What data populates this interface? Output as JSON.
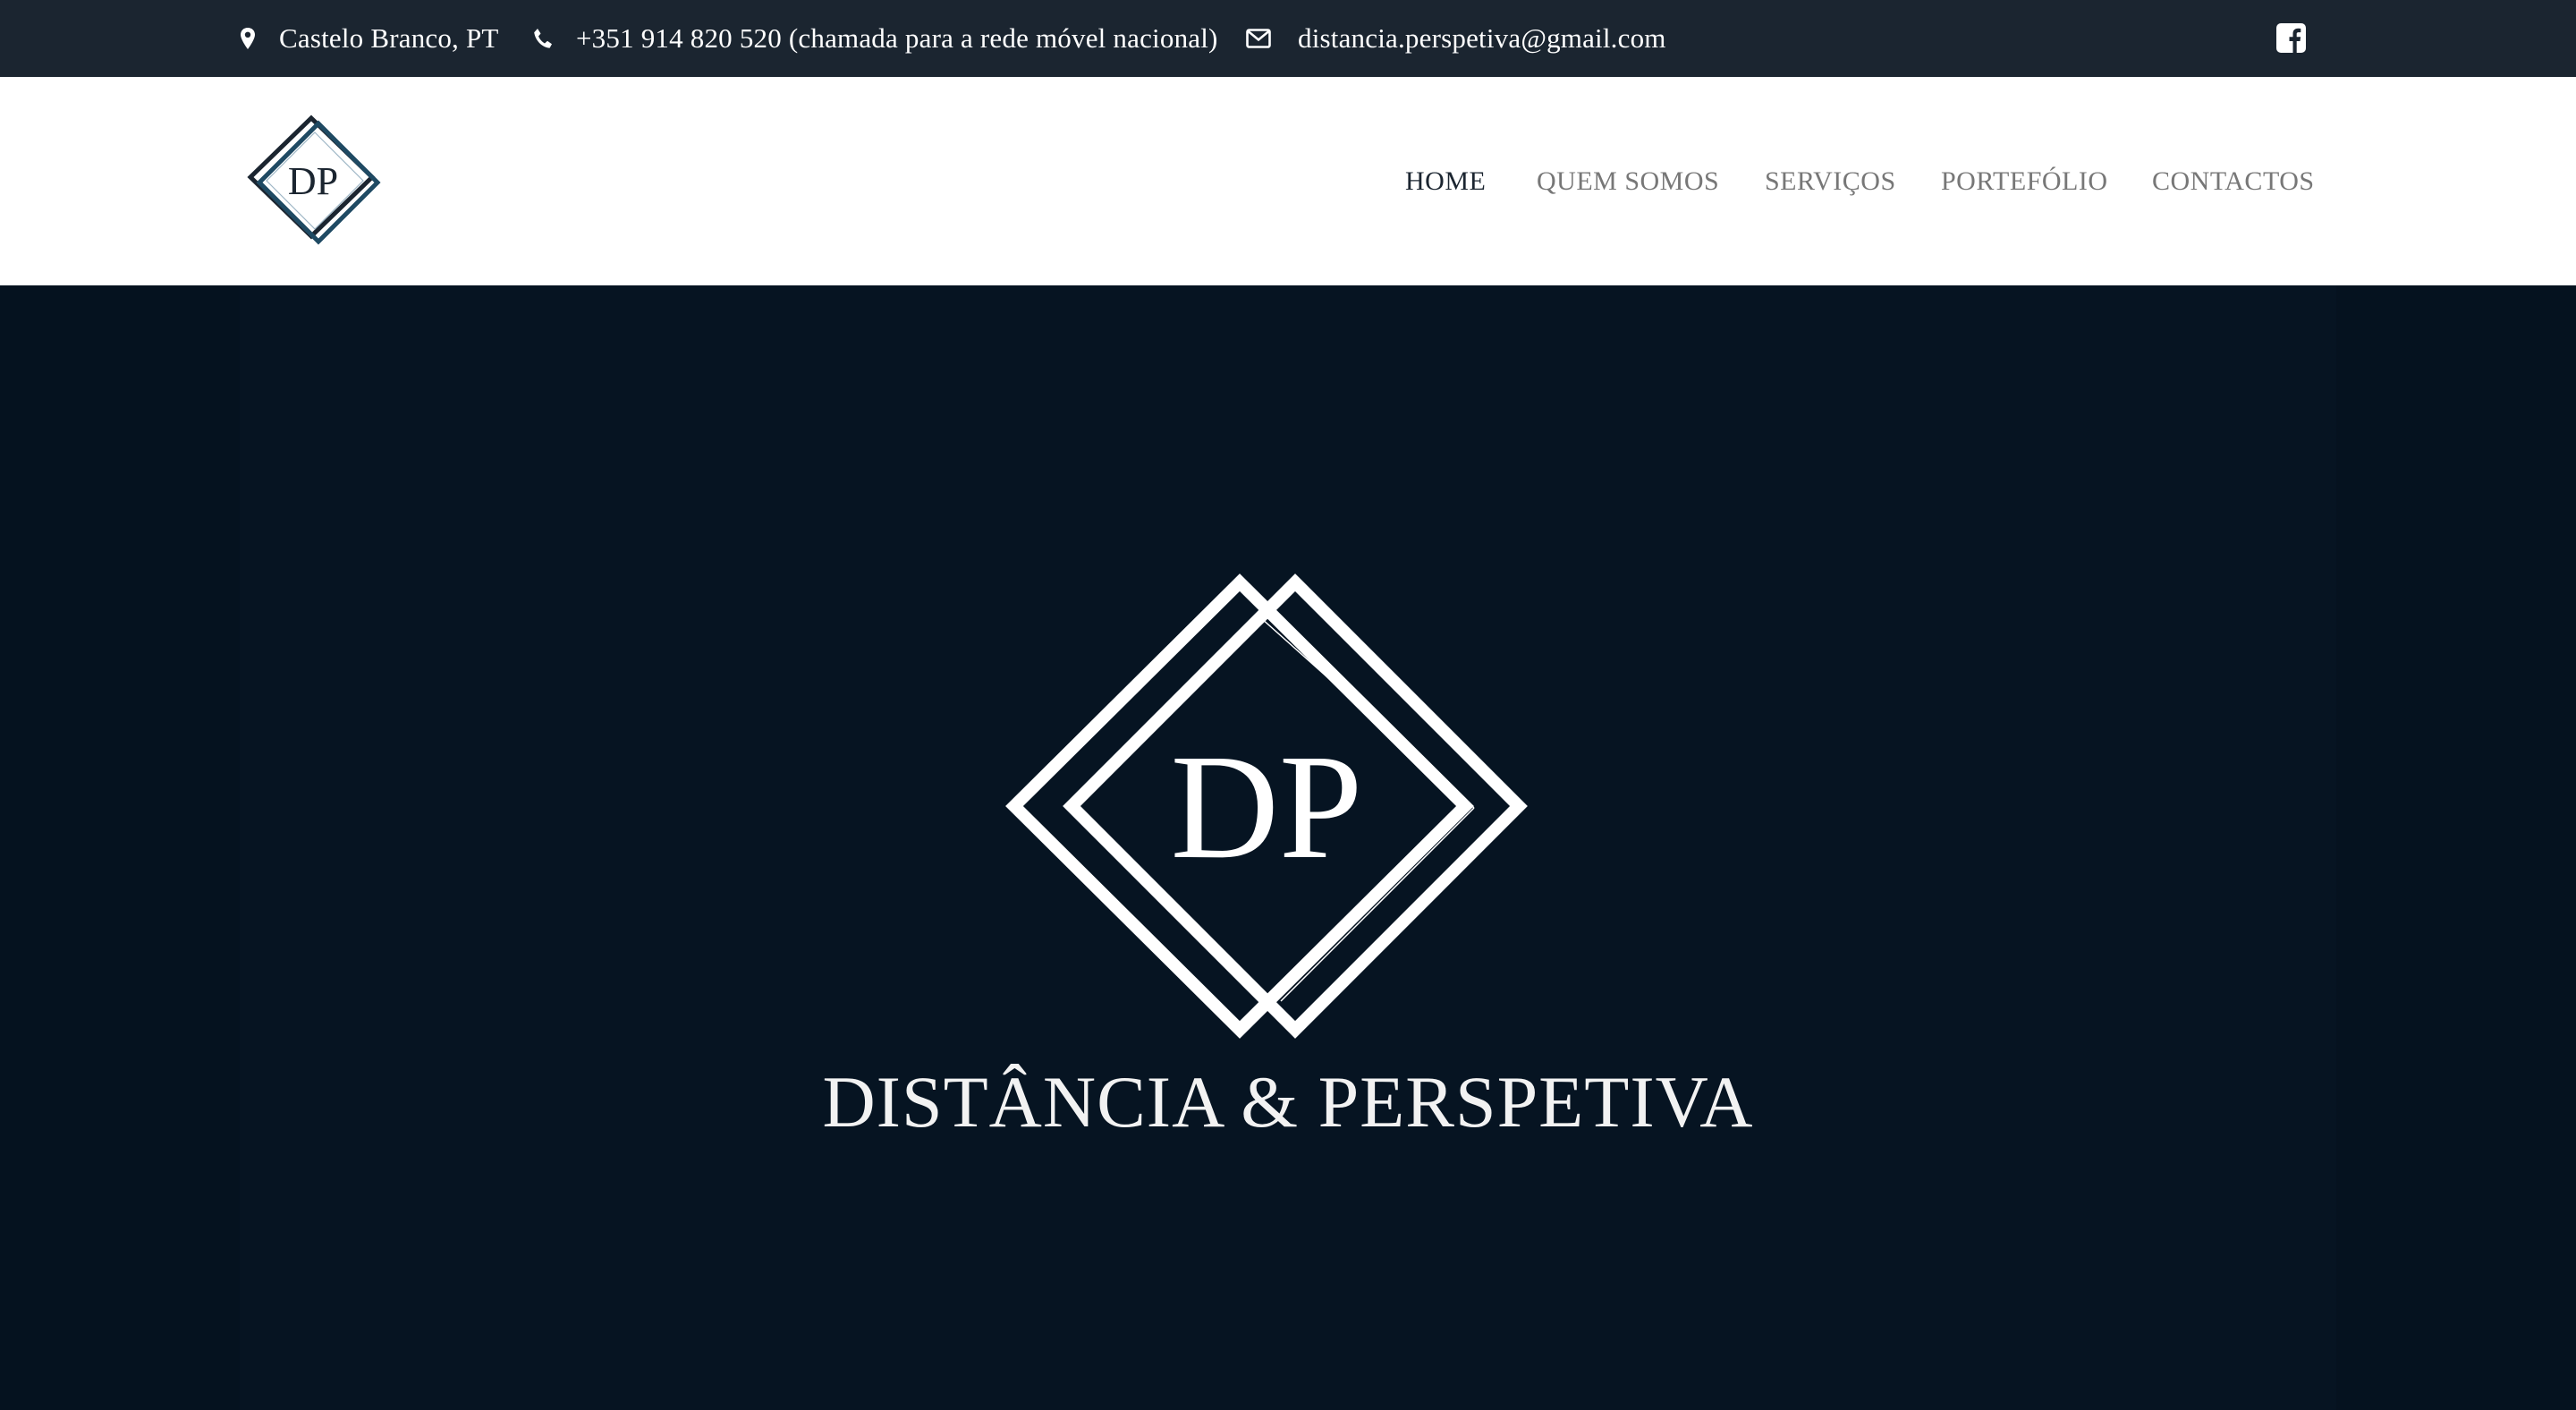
{
  "topbar": {
    "location": "Castelo Branco, PT",
    "location_icon": "map-marker-icon",
    "phone": "+351 914 820 520 (chamada para a rede móvel nacional)",
    "phone_icon": "phone-icon",
    "email": "distancia.perspetiva@gmail.com",
    "email_icon": "envelope-icon",
    "social_icon": "facebook-icon",
    "background": "#1b2530"
  },
  "logo": {
    "monogram": "DP",
    "accent": "#1f4a63"
  },
  "nav": {
    "items": [
      {
        "label": "HOME",
        "active": true
      },
      {
        "label": "QUEM SOMOS",
        "active": false
      },
      {
        "label": "SERVIÇOS",
        "active": false
      },
      {
        "label": "PORTEFÓLIO",
        "active": false
      },
      {
        "label": "CONTACTOS",
        "active": false
      }
    ],
    "active_color": "#1b2530",
    "inactive_color": "#777777"
  },
  "hero": {
    "monogram": "DP",
    "title": "DISTÂNCIA & PERSPETIVA",
    "background": "#05121f"
  }
}
